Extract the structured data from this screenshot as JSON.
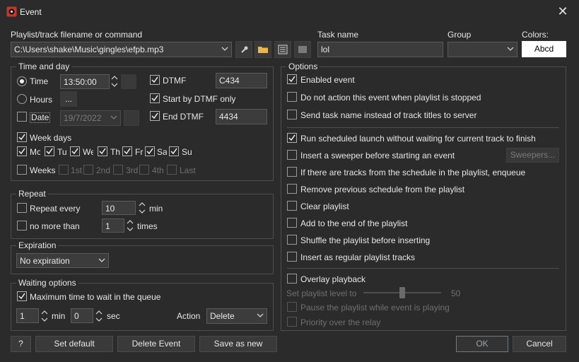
{
  "window": {
    "title": "Event"
  },
  "top": {
    "playlist_label": "Playlist/track filename or command",
    "playlist_value": "C:\\Users\\shake\\Music\\gingles\\efpb.mp3",
    "task_label": "Task name",
    "task_value": "lol",
    "group_label": "Group",
    "group_value": "",
    "colors_label": "Colors:",
    "colors_sample": "Abcd",
    "colors_sample_bg": "#ffffff"
  },
  "time_day": {
    "title": "Time and day",
    "time_label": "Time",
    "time_value": "13:50:00",
    "hours_label": "Hours",
    "hours_btn": "...",
    "date_label": "Date",
    "date_value": "19/7/2022",
    "dtmf_label": "DTMF",
    "dtmf_value": "C434",
    "start_dtmf_label": "Start by DTMF only",
    "end_dtmf_label": "End DTMF",
    "end_dtmf_value": "4434",
    "week_days_label": "Week days",
    "days": [
      "Mo",
      "Tu",
      "We",
      "Th",
      "Fr",
      "Sa",
      "Su"
    ],
    "weeks_label": "Weeks",
    "weeks": [
      "1st",
      "2nd",
      "3rd",
      "4th",
      "Last"
    ]
  },
  "repeat": {
    "title": "Repeat",
    "every_label": "Repeat every",
    "every_value": "10",
    "every_unit": "min",
    "limit_label": "no more than",
    "limit_value": "1",
    "limit_unit": "times"
  },
  "expiration": {
    "title": "Expiration",
    "value": "No expiration"
  },
  "waiting": {
    "title": "Waiting options",
    "max_label": "Maximum time to wait in the queue",
    "min_value": "1",
    "min_unit": "min",
    "sec_value": "0",
    "sec_unit": "sec",
    "action_label": "Action",
    "action_value": "Delete"
  },
  "options": {
    "title": "Options",
    "enabled": "Enabled event",
    "no_action_stopped": "Do not action this event when playlist is stopped",
    "send_task_name": "Send task name instead of track titles to server",
    "run_without_wait": "Run scheduled launch without waiting for current track to finish",
    "insert_sweeper": "Insert a sweeper before starting an event",
    "sweepers_btn": "Sweepers...",
    "enqueue": "If there are tracks from the schedule in the playlist, enqueue",
    "remove_previous": "Remove previous schedule from the playlist",
    "clear_playlist": "Clear playlist",
    "add_end": "Add to the end of the playlist",
    "shuffle": "Shuffle the playlist before inserting",
    "insert_regular": "Insert as regular playlist tracks",
    "overlay": "Overlay playback",
    "level_label": "Set playlist level to",
    "level_value": "50",
    "level_fraction": 0.5,
    "pause_playlist": "Pause the playlist while event is playing",
    "priority_relay": "Priority over the relay"
  },
  "footer": {
    "help": "?",
    "set_default": "Set default",
    "delete_event": "Delete Event",
    "save_as_new": "Save as new",
    "ok": "OK",
    "cancel": "Cancel"
  },
  "icons": [
    "app-icon",
    "close-icon",
    "chevron-down-icon",
    "microphone-icon",
    "folder-icon",
    "list-icon",
    "monitor-icon",
    "check-icon",
    "spin-up-down-icon"
  ],
  "colors": {
    "background": "#2b2b2b",
    "field": "#3c3c3c",
    "border": "#4e4e4e",
    "text": "#e6e6e6",
    "disabled": "#6f6f6f"
  }
}
